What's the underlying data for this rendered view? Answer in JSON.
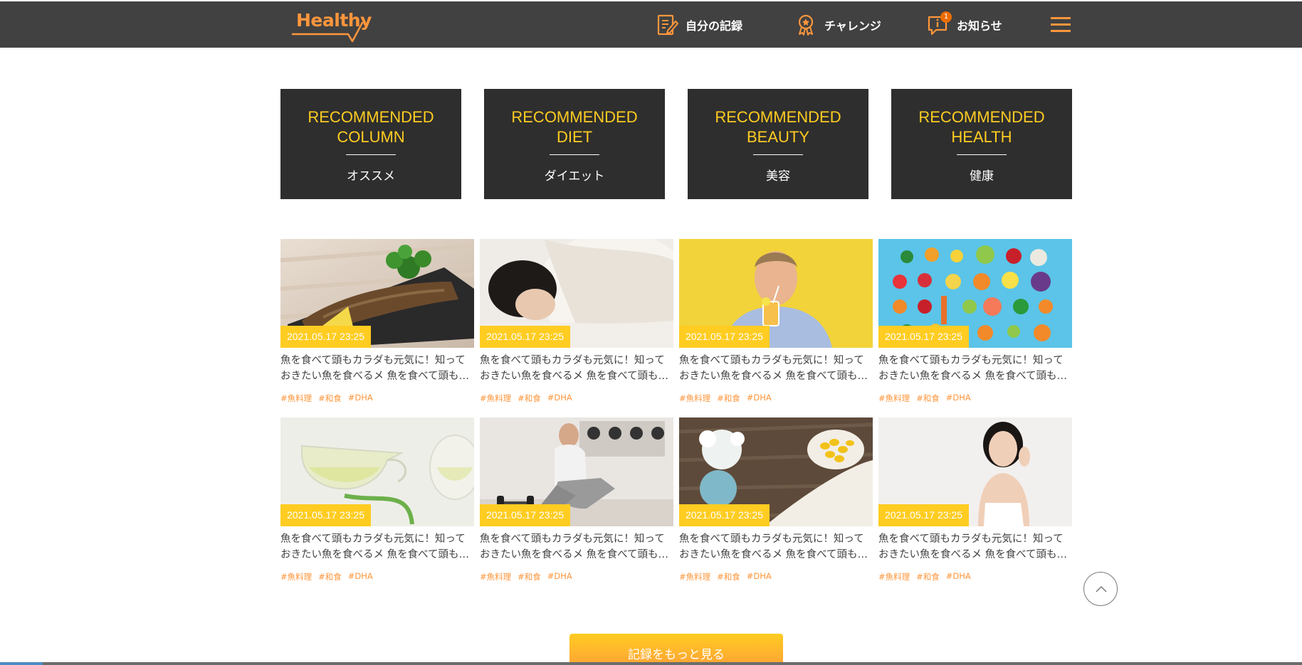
{
  "header": {
    "logo_text": "Healthy",
    "nav": [
      {
        "label": "自分の記録",
        "icon": "memo-icon"
      },
      {
        "label": "チャレンジ",
        "icon": "medal-icon"
      },
      {
        "label": "お知らせ",
        "icon": "info-icon",
        "badge": "1"
      }
    ],
    "menu_icon": "hamburger-menu-icon"
  },
  "categories": [
    {
      "title": "RECOMMENDED\nCOLUMN",
      "subtitle": "オススメ"
    },
    {
      "title": "RECOMMENDED\nDIET",
      "subtitle": "ダイエット"
    },
    {
      "title": "RECOMMENDED\nBEAUTY",
      "subtitle": "美容"
    },
    {
      "title": "RECOMMENDED\nHEALTH",
      "subtitle": "健康"
    }
  ],
  "articles": [
    {
      "date": "2021.05.17 23:25",
      "line1": "魚を食べて頭もカラダも元気に！知って",
      "line2": "おきたい魚を食べるメ 魚を食べて頭もカラダも",
      "tags": [
        "#魚料理",
        "#和食",
        "#DHA"
      ],
      "image": "grilled-fish-photo"
    },
    {
      "date": "2021.05.17 23:25",
      "line1": "魚を食べて頭もカラダも元気に！知って",
      "line2": "おきたい魚を食べるメ 魚を食べて頭もカラダも",
      "tags": [
        "#魚料理",
        "#和食",
        "#DHA"
      ],
      "image": "sleeping-woman-photo"
    },
    {
      "date": "2021.05.17 23:25",
      "line1": "魚を食べて頭もカラダも元気に！知って",
      "line2": "おきたい魚を食べるメ 魚を食べて頭もカラダも",
      "tags": [
        "#魚料理",
        "#和食",
        "#DHA"
      ],
      "image": "man-drinking-juice-photo"
    },
    {
      "date": "2021.05.17 23:25",
      "line1": "魚を食べて頭もカラダも元気に！知って",
      "line2": "おきたい魚を食べるメ 魚を食べて頭もカラダも",
      "tags": [
        "#魚料理",
        "#和食",
        "#DHA"
      ],
      "image": "vegetables-fruits-photo"
    },
    {
      "date": "2021.05.17 23:25",
      "line1": "魚を食べて頭もカラダも元気に！知って",
      "line2": "おきたい魚を食べるメ 魚を食べて頭もカラダも",
      "tags": [
        "#魚料理",
        "#和食",
        "#DHA"
      ],
      "image": "herbal-tea-photo"
    },
    {
      "date": "2021.05.17 23:25",
      "line1": "魚を食べて頭もカラダも元気に！知って",
      "line2": "おきたい魚を食べるメ 魚を食べて頭もカラダも",
      "tags": [
        "#魚料理",
        "#和食",
        "#DHA"
      ],
      "image": "woman-dumbbells-photo"
    },
    {
      "date": "2021.05.17 23:25",
      "line1": "魚を食べて頭もカラダも元気に！知って",
      "line2": "おきたい魚を食べるメ 魚を食べて頭もカラダも",
      "tags": [
        "#魚料理",
        "#和食",
        "#DHA"
      ],
      "image": "supplement-capsules-photo"
    },
    {
      "date": "2021.05.17 23:25",
      "line1": "魚を食べて頭もカラダも元気に！知って",
      "line2": "おきたい魚を食べるメ 魚を食べて頭もカラダも",
      "tags": [
        "#魚料理",
        "#和食",
        "#DHA"
      ],
      "image": "smiling-woman-photo"
    }
  ],
  "more_button": "記録をもっと見る",
  "scroll_top_icon": "chevron-up-icon",
  "colors": {
    "primary": "#ff963c",
    "secondary": "#ffcc21",
    "dark": "#2e2e2e",
    "header": "#414141"
  }
}
